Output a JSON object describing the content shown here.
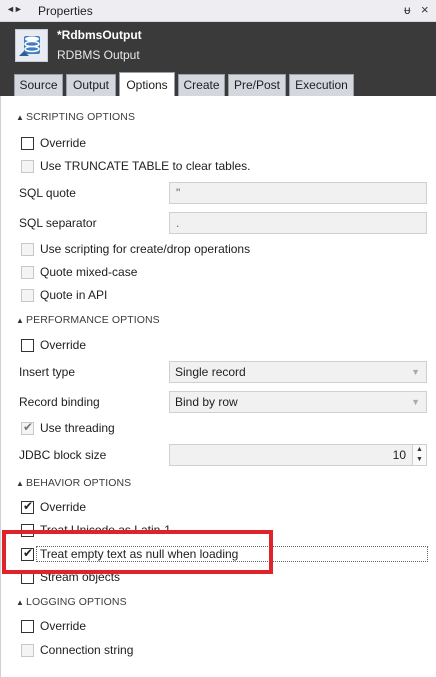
{
  "panel": {
    "title": "Properties",
    "nav_arrows": "◄►",
    "pin_glyph": "ᵾ",
    "close_glyph": "×"
  },
  "header": {
    "name": "*RdbmsOutput",
    "type": "RDBMS Output",
    "icon": "database-icon"
  },
  "tabs": [
    {
      "label": "Source",
      "active": false
    },
    {
      "label": "Output",
      "active": false
    },
    {
      "label": "Options",
      "active": true
    },
    {
      "label": "Create",
      "active": false
    },
    {
      "label": "Pre/Post",
      "active": false
    },
    {
      "label": "Execution",
      "active": false
    }
  ],
  "sections": {
    "scripting": {
      "title": "SCRIPTING OPTIONS",
      "override": {
        "label": "Override",
        "checked": false
      },
      "truncate": {
        "label": "Use TRUNCATE TABLE to clear tables.",
        "checked": false
      },
      "sql_quote": {
        "label": "SQL quote",
        "value": "\""
      },
      "sql_separator": {
        "label": "SQL separator",
        "value": "."
      },
      "use_scripting": {
        "label": "Use scripting for create/drop operations",
        "checked": false
      },
      "quote_mixed": {
        "label": "Quote mixed-case",
        "checked": false
      },
      "quote_api": {
        "label": "Quote in API",
        "checked": false
      }
    },
    "performance": {
      "title": "PERFORMANCE OPTIONS",
      "override": {
        "label": "Override",
        "checked": false
      },
      "insert_type": {
        "label": "Insert type",
        "value": "Single record"
      },
      "record_binding": {
        "label": "Record binding",
        "value": "Bind by row"
      },
      "use_threading": {
        "label": "Use threading",
        "checked": true
      },
      "jdbc_block_size": {
        "label": "JDBC block size",
        "value": "10"
      }
    },
    "behavior": {
      "title": "BEHAVIOR OPTIONS",
      "override": {
        "label": "Override",
        "checked": true
      },
      "treat_unicode": {
        "label": "Treat Unicode as Latin-1",
        "checked": false
      },
      "treat_empty": {
        "label": "Treat empty text as null when loading",
        "checked": true
      },
      "stream_objects": {
        "label": "Stream objects",
        "checked": false
      }
    },
    "logging": {
      "title": "LOGGING OPTIONS",
      "override": {
        "label": "Override",
        "checked": false
      },
      "connection_string": {
        "label": "Connection string",
        "checked": false
      }
    }
  },
  "colors": {
    "header_bg": "#3a3a3a",
    "highlight": "#e0222b"
  }
}
